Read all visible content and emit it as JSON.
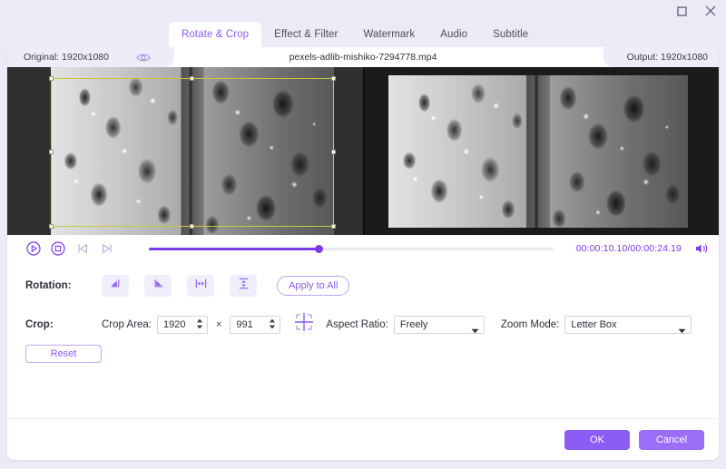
{
  "titlebar": {
    "maximize_icon": "maximize-icon",
    "close_icon": "close-icon"
  },
  "tabs": [
    {
      "label": "Rotate & Crop",
      "active": true
    },
    {
      "label": "Effect & Filter",
      "active": false
    },
    {
      "label": "Watermark",
      "active": false
    },
    {
      "label": "Audio",
      "active": false
    },
    {
      "label": "Subtitle",
      "active": false
    }
  ],
  "info": {
    "original_label": "Original: 1920x1080",
    "preview_toggle_icon": "eye-icon",
    "filename": "pexels-adlib-mishiko-7294778.mp4",
    "output_label": "Output: 1920x1080"
  },
  "player": {
    "play_icon": "play-circle-icon",
    "stop_icon": "stop-circle-icon",
    "prev_frame_icon": "previous-frame-icon",
    "next_frame_icon": "next-frame-icon",
    "current_time": "00:00:10.10",
    "separator": "/",
    "total_time": "00:00:24.19",
    "timecode": "00:00:10.10/00:00:24.19",
    "progress_percent": 42,
    "volume_icon": "volume-icon"
  },
  "rotation": {
    "label": "Rotation:",
    "buttons": [
      {
        "name": "rotate-left-button",
        "icon": "rotate-left-icon"
      },
      {
        "name": "rotate-right-button",
        "icon": "rotate-right-icon"
      },
      {
        "name": "flip-horizontal-button",
        "icon": "flip-horizontal-icon"
      },
      {
        "name": "flip-vertical-button",
        "icon": "flip-vertical-icon"
      }
    ],
    "apply_to_all_label": "Apply to All"
  },
  "crop": {
    "label": "Crop:",
    "crop_area_label": "Crop Area:",
    "width_value": "1920",
    "height_value": "991",
    "multiply_symbol": "×",
    "center_icon": "crop-center-icon",
    "aspect_ratio_label": "Aspect Ratio:",
    "aspect_ratio_value": "Freely",
    "zoom_mode_label": "Zoom Mode:",
    "zoom_mode_value": "Letter Box",
    "reset_label": "Reset"
  },
  "footer": {
    "ok_label": "OK",
    "cancel_label": "Cancel"
  },
  "colors": {
    "accent": "#8b5cf6",
    "accent_strong": "#7c3aed",
    "window_bg": "#eceaf7",
    "crop_outline": "#c8c83a"
  }
}
